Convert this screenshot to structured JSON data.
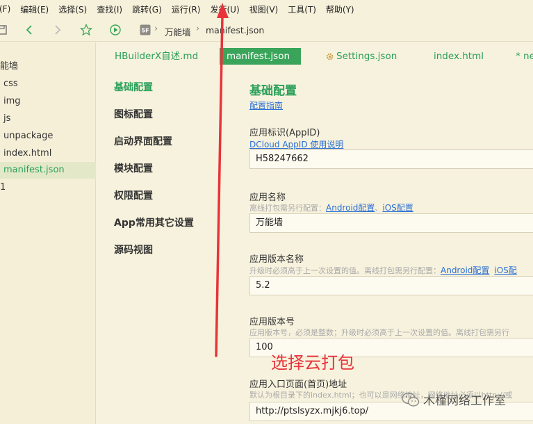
{
  "menu": [
    "(F)",
    "编辑(E)",
    "选择(S)",
    "查找(I)",
    "跳转(G)",
    "运行(R)",
    "发行(U)",
    "视图(V)",
    "工具(T)",
    "帮助(Y)"
  ],
  "breadcrumb": {
    "project": "万能墙",
    "file": "manifest.json"
  },
  "tree": {
    "root": "能墙",
    "items": [
      "css",
      "img",
      "js",
      "unpackage",
      "index.html",
      "manifest.json"
    ],
    "extra": "1"
  },
  "tabs": [
    "HBuilderX自述.md",
    "manifest.json",
    "Settings.json",
    "index.html",
    "* ne"
  ],
  "nav": [
    "基础配置",
    "图标配置",
    "启动界面配置",
    "模块配置",
    "权限配置",
    "App常用其它设置",
    "源码视图"
  ],
  "form": {
    "title": "基础配置",
    "guide_link": "配置指南",
    "appid_label": "应用标识(AppID)",
    "appid_link": "DCloud AppID 使用说明",
    "appid_value": "H58247662",
    "name_label": "应用名称",
    "name_hint": "离线打包需另行配置：",
    "name_hint_link1": "Android配置",
    "name_hint_sep": "、",
    "name_hint_link2": "iOS配置",
    "name_value": "万能墙",
    "version_name_label": "应用版本名称",
    "version_name_hint": "升级时必须高于上一次设置的值。离线打包需另行配置：",
    "version_name_hint_link1": "Android配置",
    "version_name_hint_link2": "iOS配",
    "version_name_value": "5.2",
    "version_code_label": "应用版本号",
    "version_code_hint": "应用版本号，必须是整数；升级时必须高于上一次设置的值。离线打包需另行",
    "version_code_value": "100",
    "entry_label": "应用入口页面(首页)地址",
    "entry_hint": "默认为根目录下的index.html；也可以是网络地址，网络地址必须以http://或",
    "entry_value": "http://ptslsyzx.mjkj6.top/"
  },
  "annotation": "选择云打包",
  "watermark": "木槿网络工作室",
  "colors": {
    "accent": "#3aa55a",
    "annotation": "#e8333a",
    "link": "#2a6fd6"
  }
}
